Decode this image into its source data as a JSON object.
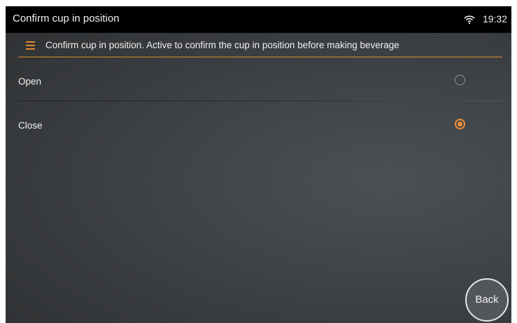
{
  "status_bar": {
    "title": "Confirm cup in position",
    "time": "19:32",
    "wifi_icon": "wifi-icon"
  },
  "description": {
    "menu_icon": "menu-icon",
    "text": "Confirm cup in position. Active to confirm the cup in position before making beverage"
  },
  "options": [
    {
      "label": "Open",
      "selected": false
    },
    {
      "label": "Close",
      "selected": true
    }
  ],
  "back_button": {
    "label": "Back"
  },
  "colors": {
    "accent": "#f0913a",
    "status_bar_bg": "#000000",
    "text": "#f2f2f2"
  }
}
